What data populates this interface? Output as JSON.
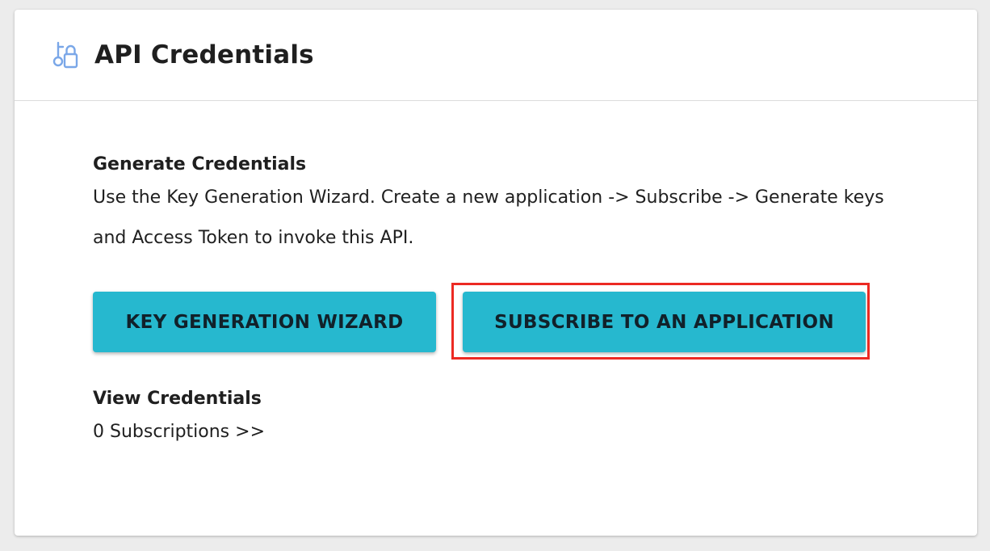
{
  "header": {
    "title": "API Credentials",
    "icon": "key-lock-icon"
  },
  "generate": {
    "title": "Generate Credentials",
    "description": "Use the Key Generation Wizard. Create a new application -> Subscribe -> Generate keys and Access Token to invoke this API."
  },
  "buttons": {
    "wizard_label": "KEY GENERATION WIZARD",
    "subscribe_label": "SUBSCRIBE TO AN APPLICATION"
  },
  "view": {
    "title": "View Credentials",
    "subscriptions_link": "0 Subscriptions >>"
  },
  "colors": {
    "accent": "#26b8cf",
    "highlight": "#ec2a23",
    "icon": "#7aa7e8"
  }
}
